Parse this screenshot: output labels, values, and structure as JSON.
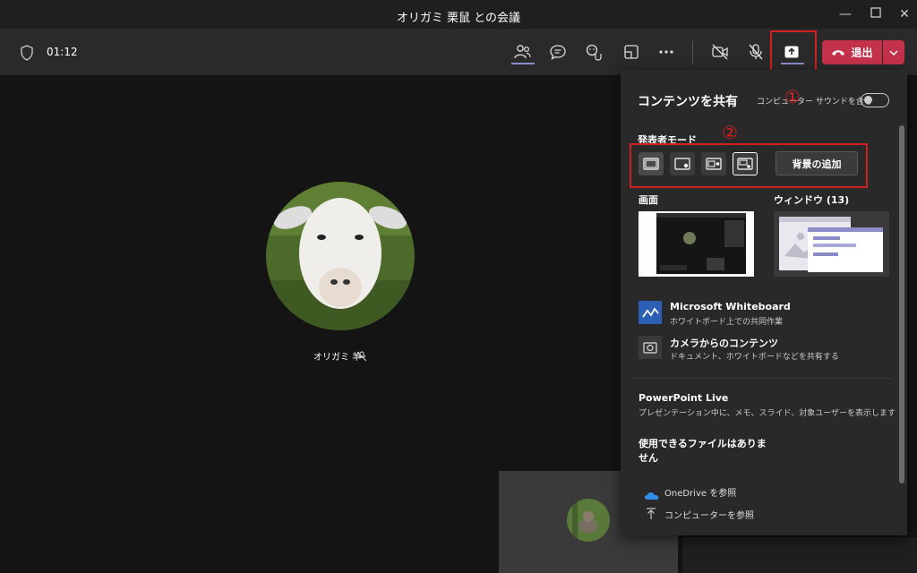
{
  "window": {
    "title": "オリガミ 栗鼠 との会議",
    "minimize_icon": "minimize-icon",
    "maximize_icon": "maximize-icon",
    "close_icon": "close-icon"
  },
  "toolbar": {
    "timer": "01:12",
    "leave_label": "退出",
    "leave_color": "#c4314b",
    "accent": "#6264a7"
  },
  "participant": {
    "name": "オリガミ 羊"
  },
  "share_panel": {
    "title": "コンテンツを共有",
    "computer_sound_label": "コンピューター サウンドを含む",
    "presenter_mode_label": "発表者モード",
    "background_button": "背景の追加",
    "screen_label": "画面",
    "window_label": "ウィンドウ (13)",
    "whiteboard_title": "Microsoft Whiteboard",
    "whiteboard_sub": "ホワイトボード上での共同作業",
    "camera_title": "カメラからのコンテンツ",
    "camera_sub": "ドキュメント、ホワイトボードなどを共有する",
    "ppt_title": "PowerPoint Live",
    "ppt_sub": "プレゼンテーション中に、メモ、スライド、対象ユーザーを表示します",
    "no_files_line1": "使用できるファイルはありま",
    "no_files_line2": "せん",
    "onedrive_label": "OneDrive を参照",
    "computer_browse_label": "コンピューターを参照"
  },
  "annotations": {
    "marker1": "①",
    "marker2": "②",
    "color": "#d02020"
  }
}
